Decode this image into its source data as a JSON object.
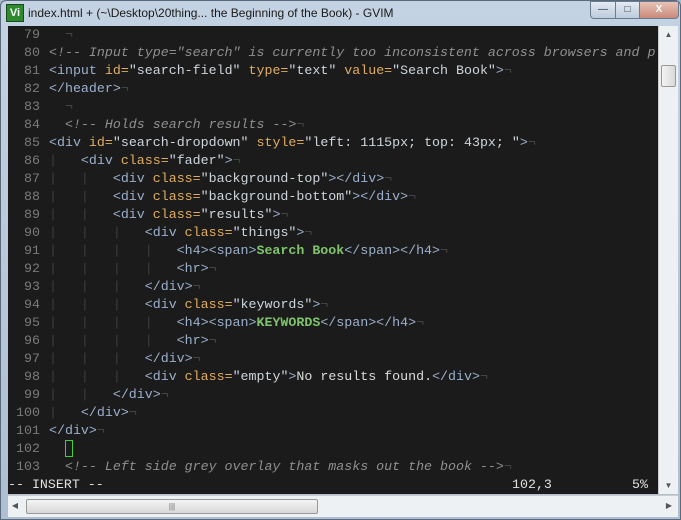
{
  "window": {
    "title": "index.html + (~\\Desktop\\20thing... the Beginning of the Book) - GVIM",
    "icon_label": "Vi",
    "minimize": "—",
    "maximize": "□",
    "close": "X"
  },
  "colors": {
    "background": "#1b1b1b",
    "tag": "#9cb0cc",
    "attr": "#e0ad62",
    "string": "#cdd5dc",
    "comment": "#8f8f8f",
    "bold": "#7fc46c",
    "cursor": "#3fcf3f"
  },
  "lines": [
    {
      "n": "79",
      "tokens": [
        [
          "text",
          "  "
        ],
        [
          "eol",
          "¬"
        ]
      ]
    },
    {
      "n": "80",
      "tokens": [
        [
          "com",
          "<!-- Input type=\"search\" is currently too inconsistent across browsers and p"
        ]
      ]
    },
    {
      "n": "81",
      "tokens": [
        [
          "tag",
          "<input "
        ],
        [
          "attr",
          "id="
        ],
        [
          "str",
          "\"search-field\" "
        ],
        [
          "attr",
          "type="
        ],
        [
          "str",
          "\"text\" "
        ],
        [
          "attr",
          "value="
        ],
        [
          "str",
          "\"Search Book\""
        ],
        [
          "tag",
          ">"
        ],
        [
          "eol",
          "¬"
        ]
      ]
    },
    {
      "n": "82",
      "tokens": [
        [
          "tag",
          "</header>"
        ],
        [
          "eol",
          "¬"
        ]
      ]
    },
    {
      "n": "83",
      "tokens": [
        [
          "text",
          "  "
        ],
        [
          "eol",
          "¬"
        ]
      ]
    },
    {
      "n": "84",
      "tokens": [
        [
          "text",
          "  "
        ],
        [
          "com",
          "<!-- Holds search results -->"
        ],
        [
          "eol",
          "¬"
        ]
      ]
    },
    {
      "n": "85",
      "tokens": [
        [
          "tag",
          "<div "
        ],
        [
          "attr",
          "id="
        ],
        [
          "str",
          "\"search-dropdown\" "
        ],
        [
          "attr",
          "style="
        ],
        [
          "str",
          "\"left: 1115px; top: 43px; \""
        ],
        [
          "tag",
          ">"
        ],
        [
          "eol",
          "¬"
        ]
      ]
    },
    {
      "n": "86",
      "tokens": [
        [
          "guide",
          "|   "
        ],
        [
          "tag",
          "<div "
        ],
        [
          "attr",
          "class="
        ],
        [
          "str",
          "\"fader\""
        ],
        [
          "tag",
          ">"
        ],
        [
          "eol",
          "¬"
        ]
      ]
    },
    {
      "n": "87",
      "tokens": [
        [
          "guide",
          "|   |   "
        ],
        [
          "tag",
          "<div "
        ],
        [
          "attr",
          "class="
        ],
        [
          "str",
          "\"background-top\""
        ],
        [
          "tag",
          "></div>"
        ],
        [
          "eol",
          "¬"
        ]
      ]
    },
    {
      "n": "88",
      "tokens": [
        [
          "guide",
          "|   |   "
        ],
        [
          "tag",
          "<div "
        ],
        [
          "attr",
          "class="
        ],
        [
          "str",
          "\"background-bottom\""
        ],
        [
          "tag",
          "></div>"
        ],
        [
          "eol",
          "¬"
        ]
      ]
    },
    {
      "n": "89",
      "tokens": [
        [
          "guide",
          "|   |   "
        ],
        [
          "tag",
          "<div "
        ],
        [
          "attr",
          "class="
        ],
        [
          "str",
          "\"results\""
        ],
        [
          "tag",
          ">"
        ],
        [
          "eol",
          "¬"
        ]
      ]
    },
    {
      "n": "90",
      "tokens": [
        [
          "guide",
          "|   |   |   "
        ],
        [
          "tag",
          "<div "
        ],
        [
          "attr",
          "class="
        ],
        [
          "str",
          "\"things\""
        ],
        [
          "tag",
          ">"
        ],
        [
          "eol",
          "¬"
        ]
      ]
    },
    {
      "n": "91",
      "tokens": [
        [
          "guide",
          "|   |   |   |   "
        ],
        [
          "tag",
          "<h4><span>"
        ],
        [
          "green",
          "Search Book"
        ],
        [
          "tag",
          "</span></h4>"
        ],
        [
          "eol",
          "¬"
        ]
      ]
    },
    {
      "n": "92",
      "tokens": [
        [
          "guide",
          "|   |   |   |   "
        ],
        [
          "tag",
          "<hr>"
        ],
        [
          "eol",
          "¬"
        ]
      ]
    },
    {
      "n": "93",
      "tokens": [
        [
          "guide",
          "|   |   |   "
        ],
        [
          "tag",
          "</div>"
        ],
        [
          "eol",
          "¬"
        ]
      ]
    },
    {
      "n": "94",
      "tokens": [
        [
          "guide",
          "|   |   |   "
        ],
        [
          "tag",
          "<div "
        ],
        [
          "attr",
          "class="
        ],
        [
          "str",
          "\"keywords\""
        ],
        [
          "tag",
          ">"
        ],
        [
          "eol",
          "¬"
        ]
      ]
    },
    {
      "n": "95",
      "tokens": [
        [
          "guide",
          "|   |   |   |   "
        ],
        [
          "tag",
          "<h4><span>"
        ],
        [
          "green",
          "KEYWORDS"
        ],
        [
          "tag",
          "</span></h4>"
        ],
        [
          "eol",
          "¬"
        ]
      ]
    },
    {
      "n": "96",
      "tokens": [
        [
          "guide",
          "|   |   |   |   "
        ],
        [
          "tag",
          "<hr>"
        ],
        [
          "eol",
          "¬"
        ]
      ]
    },
    {
      "n": "97",
      "tokens": [
        [
          "guide",
          "|   |   |   "
        ],
        [
          "tag",
          "</div>"
        ],
        [
          "eol",
          "¬"
        ]
      ]
    },
    {
      "n": "98",
      "tokens": [
        [
          "guide",
          "|   |   |   "
        ],
        [
          "tag",
          "<div "
        ],
        [
          "attr",
          "class="
        ],
        [
          "str",
          "\"empty\""
        ],
        [
          "tag",
          ">"
        ],
        [
          "text",
          "No results found."
        ],
        [
          "tag",
          "</div>"
        ],
        [
          "eol",
          "¬"
        ]
      ]
    },
    {
      "n": "99",
      "tokens": [
        [
          "guide",
          "|   |   "
        ],
        [
          "tag",
          "</div>"
        ],
        [
          "eol",
          "¬"
        ]
      ]
    },
    {
      "n": "100",
      "tokens": [
        [
          "guide",
          "|   "
        ],
        [
          "tag",
          "</div>"
        ],
        [
          "eol",
          "¬"
        ]
      ]
    },
    {
      "n": "101",
      "tokens": [
        [
          "tag",
          "</div>"
        ],
        [
          "eol",
          "¬"
        ]
      ]
    },
    {
      "n": "102",
      "tokens": [
        [
          "text",
          "  "
        ],
        [
          "cursor",
          ""
        ]
      ]
    },
    {
      "n": "103",
      "tokens": [
        [
          "text",
          "  "
        ],
        [
          "com",
          "<!-- Left side grey overlay that masks out the book -->"
        ],
        [
          "eol",
          "¬"
        ]
      ]
    }
  ],
  "status": {
    "mode": "-- INSERT --",
    "position": "102,3",
    "percent": "5%"
  },
  "scroll": {
    "vertical_percent": 5,
    "hthumb_grip": "|||"
  }
}
